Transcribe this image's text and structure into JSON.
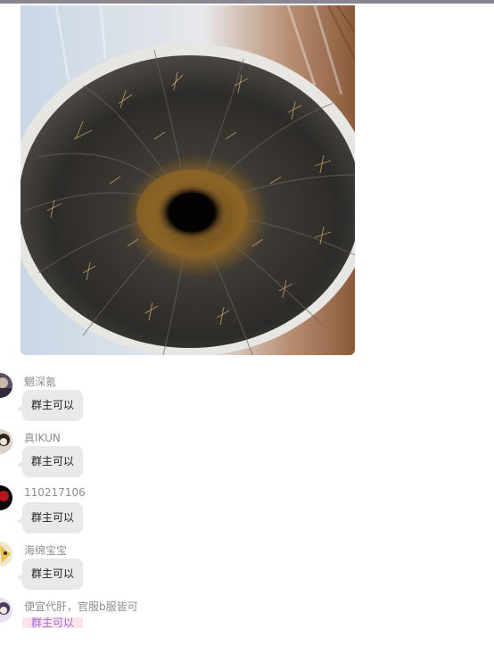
{
  "colors": {
    "top_bar": "#8a8690",
    "bubble_bg": "#e9e9e9",
    "highlight_bg": "#fde3ec",
    "highlight_text": "#9a6bd8",
    "sender_text": "#8e8e8e"
  },
  "shared_image": {
    "subject": "cactus-photo"
  },
  "messages": [
    {
      "sender": "魍深氪",
      "text": "群主可以",
      "avatar": "avatar-1"
    },
    {
      "sender": "真IKUN",
      "text": "群主可以",
      "avatar": "avatar-2"
    },
    {
      "sender": "110217106",
      "text": "群主可以",
      "avatar": "avatar-3"
    },
    {
      "sender": "海绵宝宝",
      "text": "群主可以",
      "avatar": "avatar-4"
    },
    {
      "sender": "便宜代肝，官服b服皆可",
      "text": "群主可以",
      "avatar": "avatar-5"
    }
  ]
}
